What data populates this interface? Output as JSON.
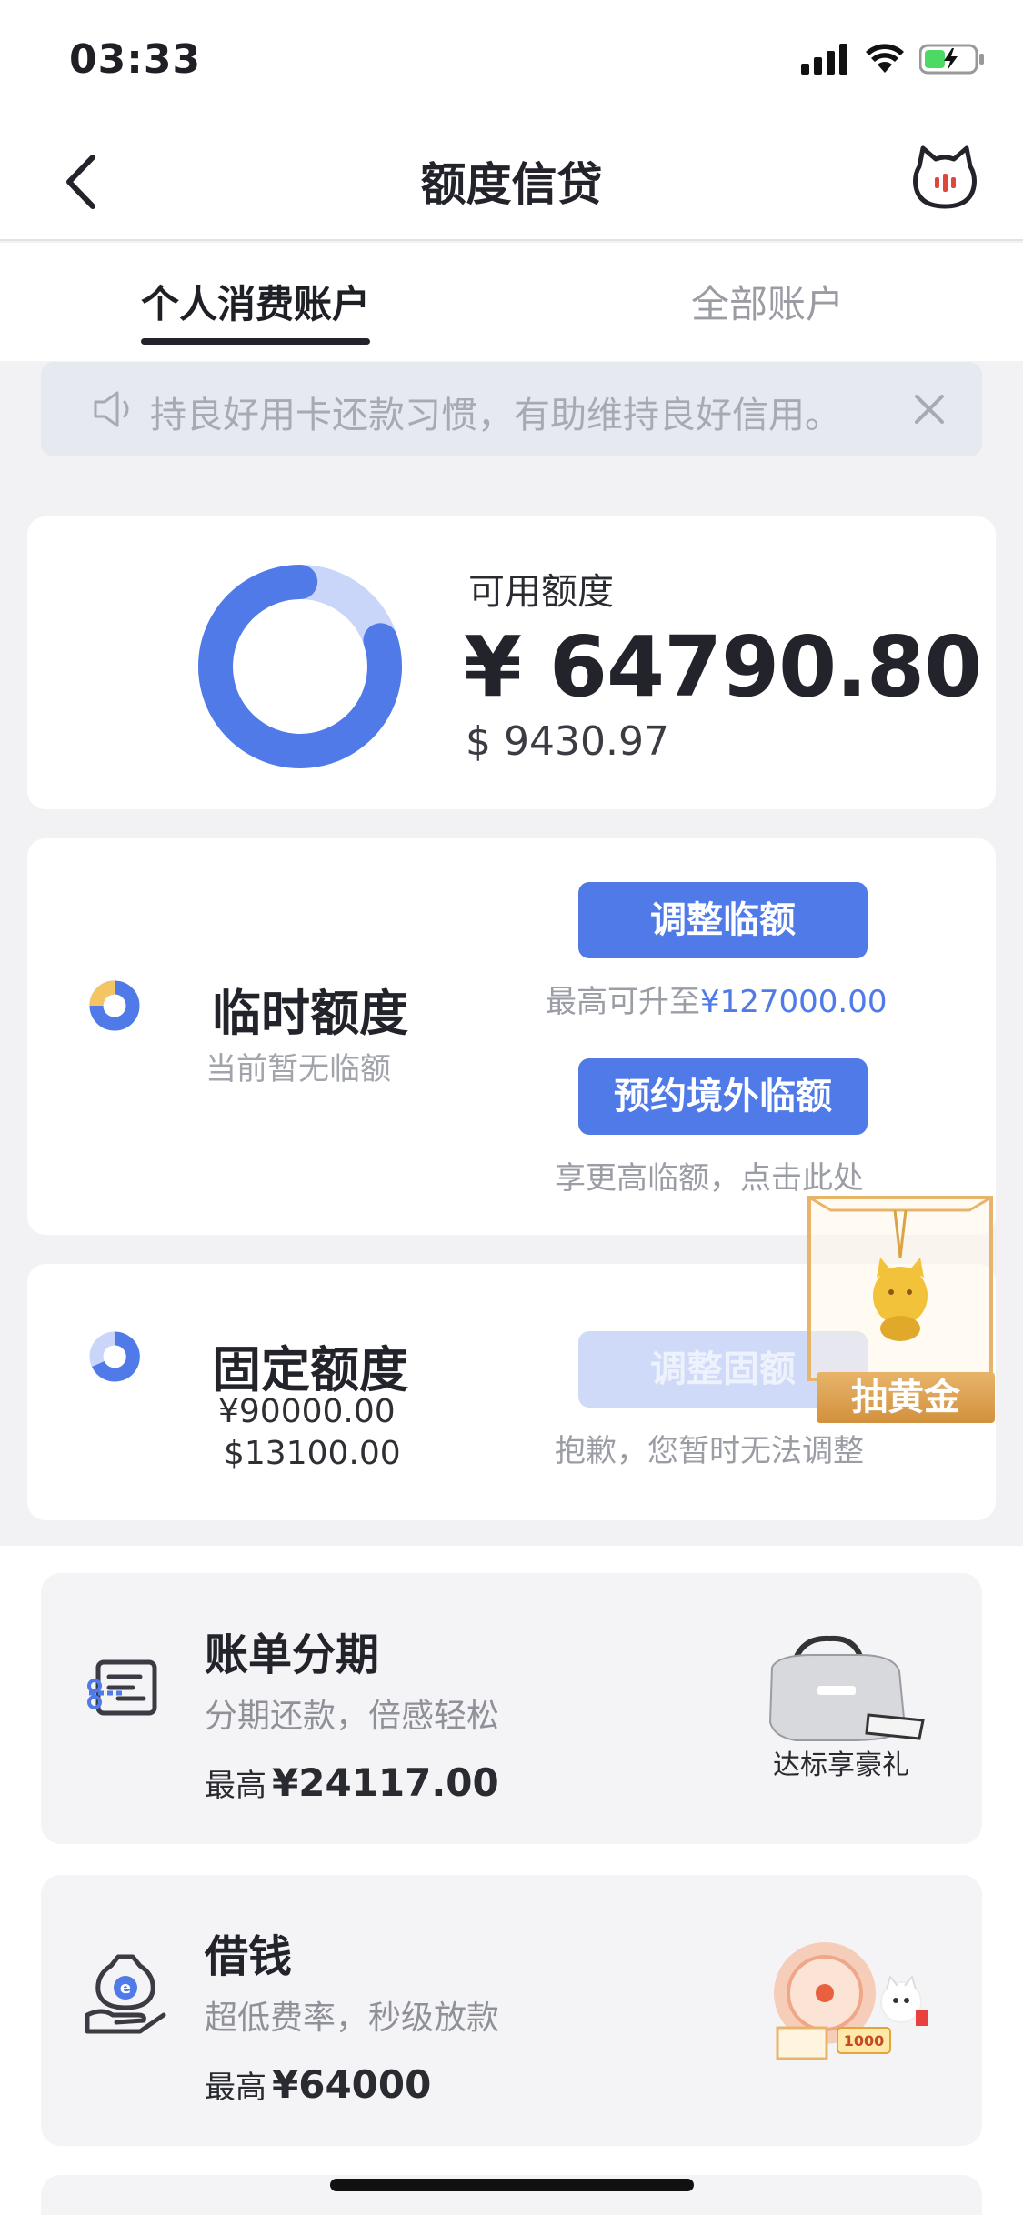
{
  "status": {
    "time": "03:33"
  },
  "nav": {
    "title": "额度信贷"
  },
  "tabs": [
    {
      "label": "个人消费账户",
      "active": true
    },
    {
      "label": "全部账户",
      "active": false
    }
  ],
  "notice": {
    "text": "持良好用卡还款习惯，有助维持良好信用。"
  },
  "available": {
    "label": "可用额度",
    "cny": "¥ 64790.80",
    "usd": "$ 9430.97",
    "used_fraction": 0.2
  },
  "temp_limit": {
    "title": "临时额度",
    "subtitle": "当前暂无临额",
    "adjust_button": "调整临额",
    "max_note_prefix": "最高可升至",
    "max_note_value": "¥127000.00",
    "overseas_button": "预约境外临额",
    "overseas_note": "享更高临额，点击此处"
  },
  "fixed_limit": {
    "title": "固定额度",
    "cny": "¥90000.00",
    "usd": "$13100.00",
    "adjust_button": "调整固额",
    "note": "抱歉，您暂时无法调整"
  },
  "gold_promo": {
    "label": "抽黄金"
  },
  "features": [
    {
      "title": "账单分期",
      "subtitle": "分期还款，倍感轻松",
      "max_prefix": "最高",
      "max_value": "¥24117.00",
      "promo": "达标享豪礼",
      "icon": "installment-icon"
    },
    {
      "title": "借钱",
      "subtitle": "超低费率，秒级放款",
      "max_prefix": "最高",
      "max_value": "¥64000",
      "promo": "",
      "icon": "loan-icon"
    }
  ],
  "colors": {
    "accent": "#4f7ae8",
    "accent_light": "#cfdaf8",
    "text_dark": "#23242b",
    "gold": "#d2913e"
  }
}
